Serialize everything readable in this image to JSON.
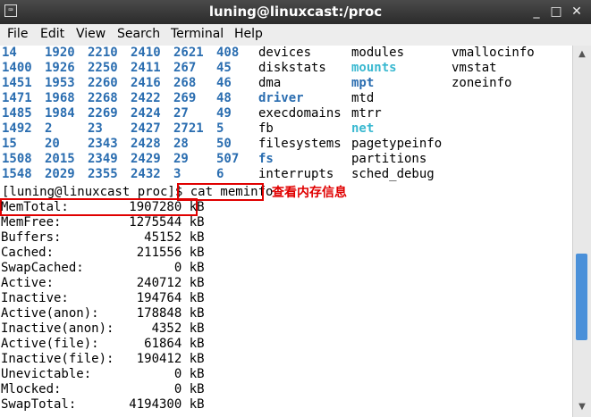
{
  "window": {
    "title": "luning@linuxcast:/proc",
    "icon_glyph": "⌨",
    "minimize_glyph": "_",
    "maximize_glyph": "□",
    "close_glyph": "✕"
  },
  "menubar": [
    "File",
    "Edit",
    "View",
    "Search",
    "Terminal",
    "Help"
  ],
  "ls_rows": [
    [
      {
        "t": "14",
        "k": "pid"
      },
      {
        "t": "1920",
        "k": "pid"
      },
      {
        "t": "2210",
        "k": "pid"
      },
      {
        "t": "2410",
        "k": "pid"
      },
      {
        "t": "2621",
        "k": "pid"
      },
      {
        "t": "408",
        "k": "pid"
      },
      {
        "t": "devices",
        "k": "file"
      },
      {
        "t": "modules",
        "k": "file"
      },
      {
        "t": "vmallocinfo",
        "k": "file"
      }
    ],
    [
      {
        "t": "1400",
        "k": "pid"
      },
      {
        "t": "1926",
        "k": "pid"
      },
      {
        "t": "2250",
        "k": "pid"
      },
      {
        "t": "2411",
        "k": "pid"
      },
      {
        "t": "267",
        "k": "pid"
      },
      {
        "t": "45",
        "k": "pid"
      },
      {
        "t": "diskstats",
        "k": "file"
      },
      {
        "t": "mounts",
        "k": "tmpfs"
      },
      {
        "t": "vmstat",
        "k": "file"
      }
    ],
    [
      {
        "t": "1451",
        "k": "pid"
      },
      {
        "t": "1953",
        "k": "pid"
      },
      {
        "t": "2260",
        "k": "pid"
      },
      {
        "t": "2416",
        "k": "pid"
      },
      {
        "t": "268",
        "k": "pid"
      },
      {
        "t": "46",
        "k": "pid"
      },
      {
        "t": "dma",
        "k": "file"
      },
      {
        "t": "mpt",
        "k": "dir"
      },
      {
        "t": "zoneinfo",
        "k": "file"
      }
    ],
    [
      {
        "t": "1471",
        "k": "pid"
      },
      {
        "t": "1968",
        "k": "pid"
      },
      {
        "t": "2268",
        "k": "pid"
      },
      {
        "t": "2422",
        "k": "pid"
      },
      {
        "t": "269",
        "k": "pid"
      },
      {
        "t": "48",
        "k": "pid"
      },
      {
        "t": "driver",
        "k": "dir"
      },
      {
        "t": "mtd",
        "k": "file"
      },
      {
        "t": "",
        "k": "file"
      }
    ],
    [
      {
        "t": "1485",
        "k": "pid"
      },
      {
        "t": "1984",
        "k": "pid"
      },
      {
        "t": "2269",
        "k": "pid"
      },
      {
        "t": "2424",
        "k": "pid"
      },
      {
        "t": "27",
        "k": "pid"
      },
      {
        "t": "49",
        "k": "pid"
      },
      {
        "t": "execdomains",
        "k": "file"
      },
      {
        "t": "mtrr",
        "k": "file"
      },
      {
        "t": "",
        "k": "file"
      }
    ],
    [
      {
        "t": "1492",
        "k": "pid"
      },
      {
        "t": "2",
        "k": "pid"
      },
      {
        "t": "23",
        "k": "pid"
      },
      {
        "t": "2427",
        "k": "pid"
      },
      {
        "t": "2721",
        "k": "pid"
      },
      {
        "t": "5",
        "k": "pid"
      },
      {
        "t": "fb",
        "k": "file"
      },
      {
        "t": "net",
        "k": "tmpfs"
      },
      {
        "t": "",
        "k": "file"
      }
    ],
    [
      {
        "t": "15",
        "k": "pid"
      },
      {
        "t": "20",
        "k": "pid"
      },
      {
        "t": "2343",
        "k": "pid"
      },
      {
        "t": "2428",
        "k": "pid"
      },
      {
        "t": "28",
        "k": "pid"
      },
      {
        "t": "50",
        "k": "pid"
      },
      {
        "t": "filesystems",
        "k": "file"
      },
      {
        "t": "pagetypeinfo",
        "k": "file"
      },
      {
        "t": "",
        "k": "file"
      }
    ],
    [
      {
        "t": "1508",
        "k": "pid"
      },
      {
        "t": "2015",
        "k": "pid"
      },
      {
        "t": "2349",
        "k": "pid"
      },
      {
        "t": "2429",
        "k": "pid"
      },
      {
        "t": "29",
        "k": "pid"
      },
      {
        "t": "507",
        "k": "pid"
      },
      {
        "t": "fs",
        "k": "dir"
      },
      {
        "t": "partitions",
        "k": "file"
      },
      {
        "t": "",
        "k": "file"
      }
    ],
    [
      {
        "t": "1548",
        "k": "pid"
      },
      {
        "t": "2029",
        "k": "pid"
      },
      {
        "t": "2355",
        "k": "pid"
      },
      {
        "t": "2432",
        "k": "pid"
      },
      {
        "t": "3",
        "k": "pid"
      },
      {
        "t": "6",
        "k": "pid"
      },
      {
        "t": "interrupts",
        "k": "file"
      },
      {
        "t": "sched_debug",
        "k": "file"
      },
      {
        "t": "",
        "k": "file"
      }
    ]
  ],
  "prompt": {
    "text": "[luning@linuxcast proc]$ ",
    "command": "cat meminfo",
    "annotation": "查看内存信息"
  },
  "meminfo": [
    "MemTotal:        1907280 kB",
    "MemFree:         1275544 kB",
    "Buffers:           45152 kB",
    "Cached:           211556 kB",
    "SwapCached:            0 kB",
    "Active:           240712 kB",
    "Inactive:         194764 kB",
    "Active(anon):     178848 kB",
    "Inactive(anon):     4352 kB",
    "Active(file):      61864 kB",
    "Inactive(file):   190412 kB",
    "Unevictable:           0 kB",
    "Mlocked:               0 kB",
    "SwapTotal:       4194300 kB"
  ],
  "colors": {
    "highlight_box": "#e00000",
    "directory": "#2a6db0",
    "special": "#39b8d0",
    "scroll_thumb": "#4a90d9"
  }
}
